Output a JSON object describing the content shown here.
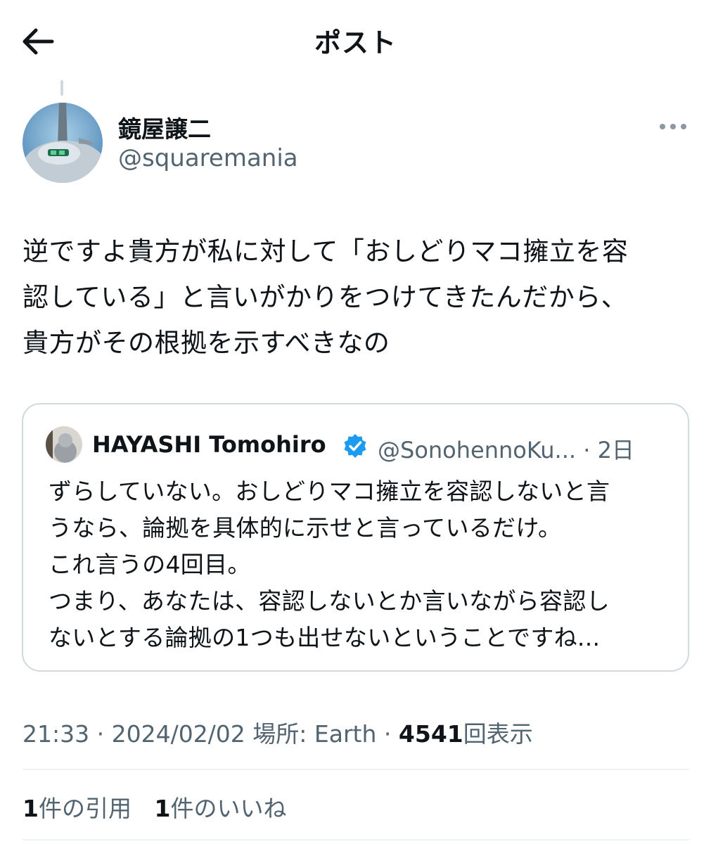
{
  "header": {
    "title": "ポスト",
    "back_icon": "arrow-left-icon"
  },
  "post": {
    "author_name": "鏡屋譲二",
    "author_handle": "@squaremania",
    "text": "逆ですよ貴方が私に対して「おしどりマコ擁立を容\n認している」と言いがかりをつけてきたんだから、\n貴方がその根拠を示すべきなの",
    "more_icon": "more-horizontal-icon"
  },
  "quote": {
    "author_name": "HAYASHI Tomohiro",
    "author_handle": "@SonohennoKu...",
    "time": "2日",
    "verified_icon": "verified-badge-icon",
    "text": "ずらしていない。おしどりマコ擁立を容認しないと言\nうなら、論拠を具体的に示せと言っているだけ。\nこれ言うの4回目。\nつまり、あなたは、容認しないとか言いながら容認し\nないとする論拠の1つも出せないということですね..."
  },
  "meta": {
    "time": "21:33",
    "date": "2024/02/02",
    "location": "場所: Earth",
    "views_count": "4541",
    "views_label": "回表示"
  },
  "stats": {
    "quotes_count": "1",
    "quotes_label": "件の引用",
    "likes_count": "1",
    "likes_label": "件のいいね"
  },
  "colors": {
    "text_primary": "#0f1419",
    "text_secondary": "#536471",
    "border": "#cfd9de",
    "verified": "#1d9bf0"
  }
}
